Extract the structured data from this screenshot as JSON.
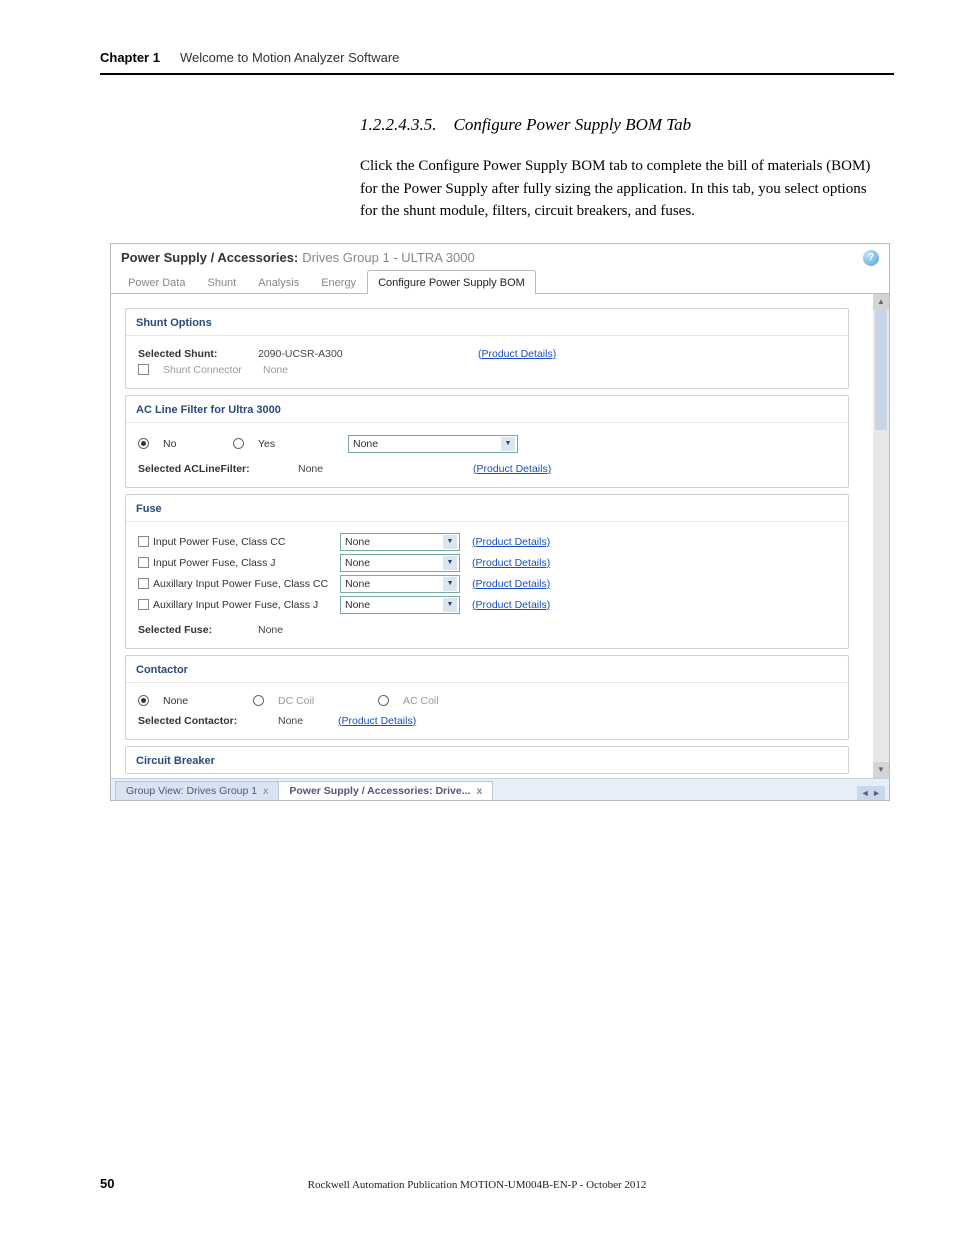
{
  "header": {
    "chapter_label": "Chapter 1",
    "chapter_title": "Welcome to Motion Analyzer Software"
  },
  "section": {
    "number": "1.2.2.4.3.5.",
    "title": "Configure Power Supply BOM Tab"
  },
  "body_paragraph": "Click the Configure Power Supply BOM tab to complete the bill of materials (BOM) for the Power Supply after fully sizing the application. In this tab, you select options for the shunt module, filters, circuit breakers, and fuses.",
  "screenshot": {
    "window_title_label": "Power Supply / Accessories:",
    "window_title_sub": "Drives Group 1 - ULTRA 3000",
    "help": "?",
    "tabs": [
      "Power Data",
      "Shunt",
      "Analysis",
      "Energy",
      "Configure Power Supply BOM"
    ],
    "active_tab_index": 4,
    "product_details": "(Product Details)",
    "shunt": {
      "heading": "Shunt Options",
      "selected_label": "Selected Shunt:",
      "selected_value": "2090-UCSR-A300",
      "connector_label": "Shunt Connector",
      "connector_value": "None"
    },
    "acline": {
      "heading": "AC Line Filter for Ultra 3000",
      "no": "No",
      "yes": "Yes",
      "dd_value": "None",
      "sel_label": "Selected ACLineFilter:",
      "sel_value": "None"
    },
    "fuse": {
      "heading": "Fuse",
      "rows": [
        "Input Power Fuse, Class CC",
        "Input Power Fuse, Class J",
        "Auxillary Input Power Fuse, Class CC",
        "Auxillary Input Power Fuse, Class J"
      ],
      "dd_value": "None",
      "sel_label": "Selected Fuse:",
      "sel_value": "None"
    },
    "contactor": {
      "heading": "Contactor",
      "none": "None",
      "dc": "DC Coil",
      "ac": "AC Coil",
      "sel_label": "Selected Contactor:",
      "sel_value": "None"
    },
    "circuit_breaker": {
      "heading": "Circuit Breaker"
    },
    "footer_tabs": {
      "t1": "Group View: Drives Group 1",
      "t2": "Power Supply / Accessories: Drive...",
      "x": "x",
      "nav": "◄ ►"
    }
  },
  "footer": {
    "page": "50",
    "pub": "Rockwell Automation Publication MOTION-UM004B-EN-P - October 2012"
  }
}
